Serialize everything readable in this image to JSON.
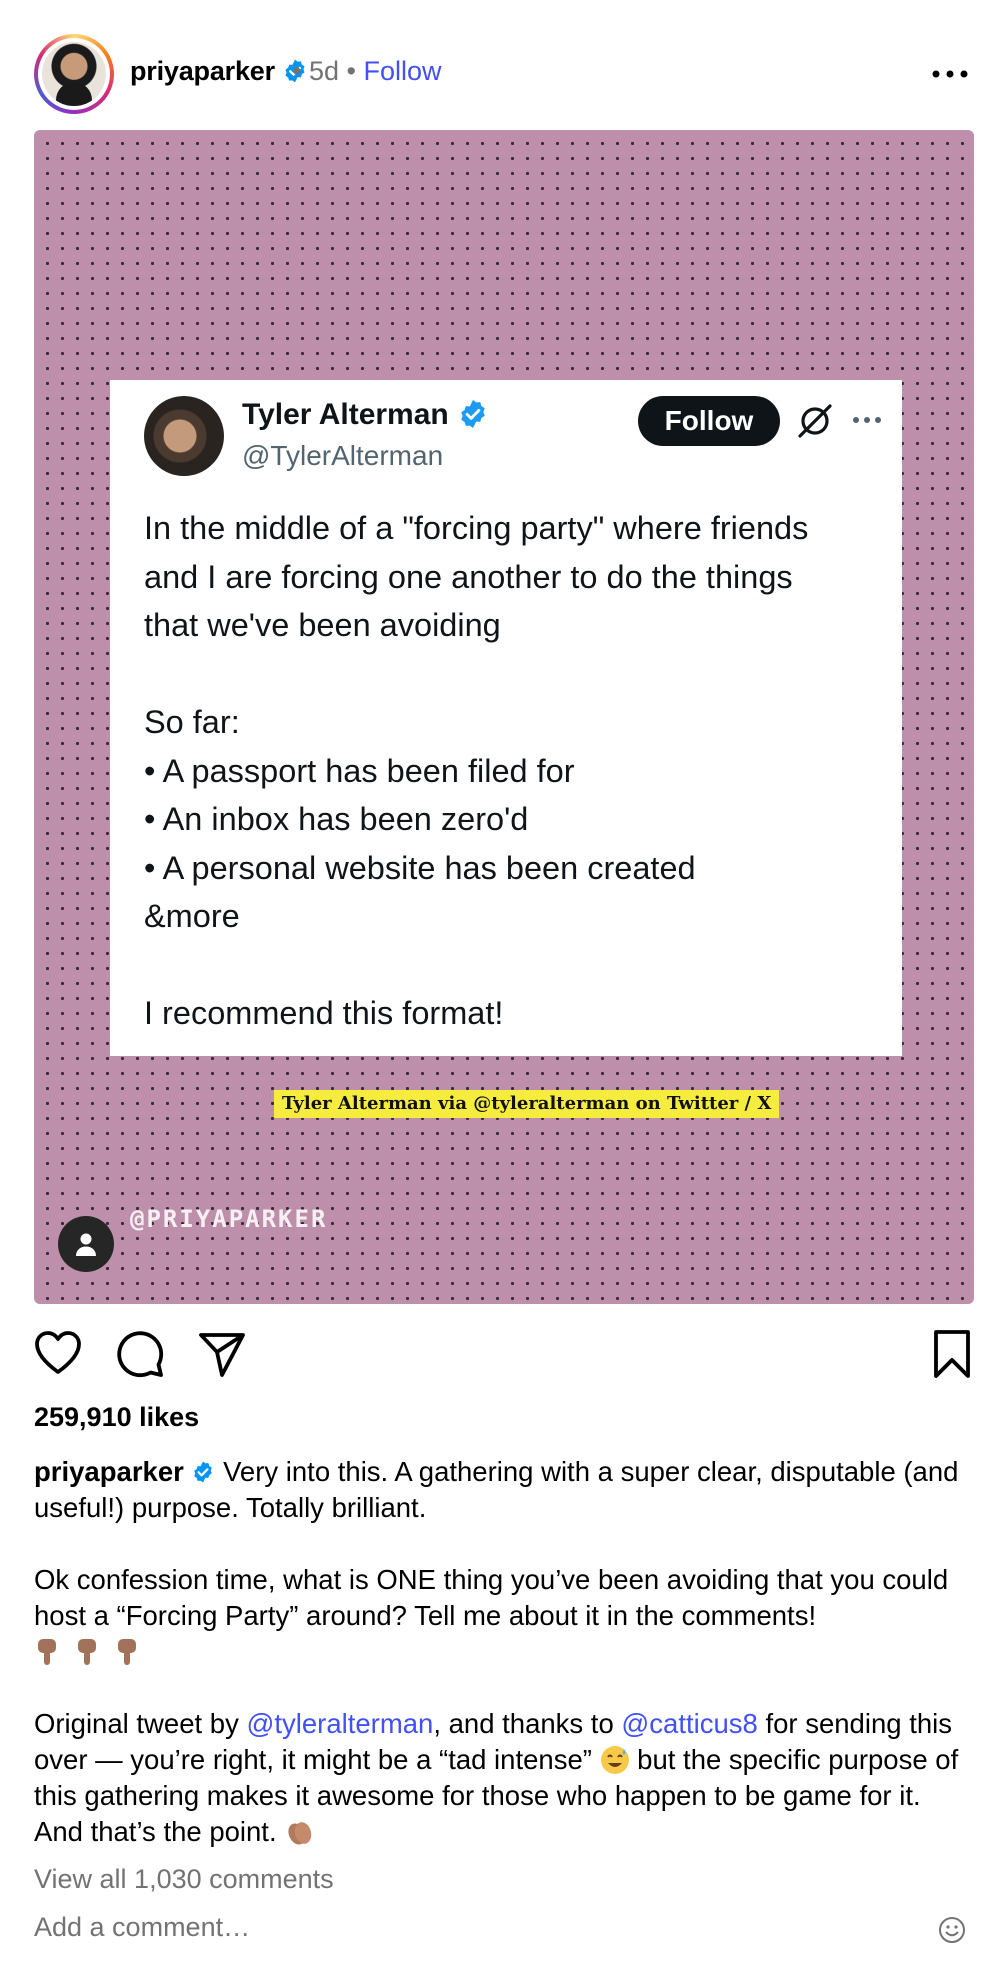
{
  "post": {
    "username": "priyaparker",
    "time_ago": "5d",
    "separator": "•",
    "follow_label": "Follow",
    "likes": "259,910 likes"
  },
  "media": {
    "tweet": {
      "name": "Tyler Alterman",
      "handle": "@TylerAlterman",
      "follow_label": "Follow",
      "lines": [
        "In the middle of a \"forcing party\" where friends",
        "and I are forcing one another to do the things",
        "that we've been avoiding",
        "",
        "So far:",
        "• A passport has been filed for",
        "• An inbox has been zero'd",
        "• A personal website has been created",
        "&more",
        "",
        "I recommend this format!"
      ]
    },
    "credit": "Tyler Alterman via @tyleralterman on Twitter / X",
    "watermark": "@PRIYAPARKER"
  },
  "caption": {
    "username": "priyaparker",
    "p1": " Very into this. A gathering with a super clear, disputable (and useful!) purpose. Totally brilliant.",
    "p2": "Ok confession time, what is ONE thing you’ve been avoiding that you could host a “Forcing Party” around? Tell me about it in the comments!",
    "p3_a": "Original tweet by ",
    "mention1": "@tyleralterman",
    "p3_b": ", and thanks to ",
    "mention2": "@catticus8",
    "p3_c": " for sending this over — you’re right, it might be a “tad intense” ",
    "p3_d": " but the specific purpose of this gathering makes it awesome for those who happen to be game for it. And that’s the point. ",
    "emojis": [
      "pointing-down-hand",
      "pointing-down-hand",
      "pointing-down-hand",
      "grinning-sweat-face",
      "clapping-hands"
    ]
  },
  "comments": {
    "view_all": "View all 1,030 comments",
    "add_placeholder": "Add a comment…"
  },
  "icons": {
    "verified_color": "#0095f6",
    "link_color": "#4150f7",
    "media_background": "#bd8faa",
    "credit_highlight": "#f5ec3e"
  }
}
